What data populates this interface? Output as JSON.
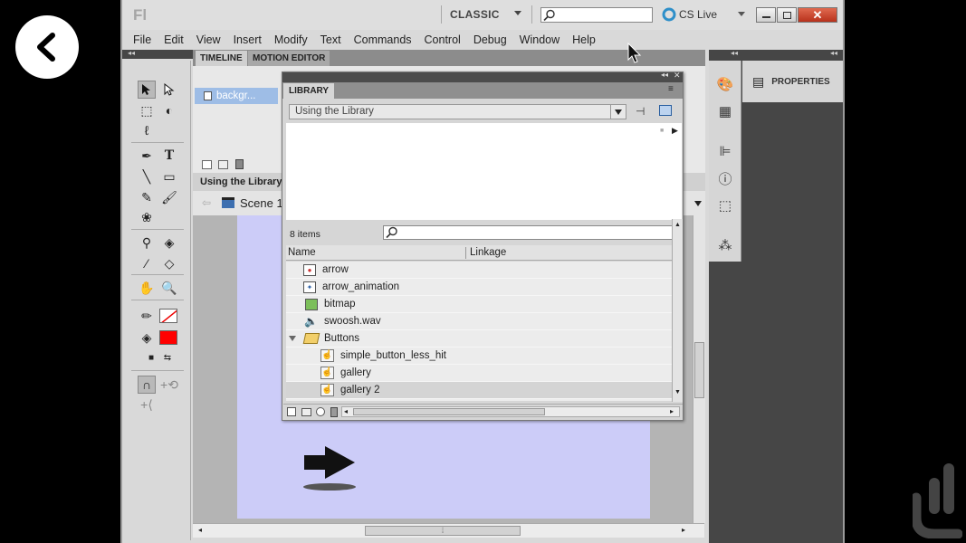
{
  "app": {
    "logo": "Fl",
    "workspace": "CLASSIC",
    "search_placeholder": "",
    "cslive": "CS Live"
  },
  "menu": [
    "File",
    "Edit",
    "View",
    "Insert",
    "Modify",
    "Text",
    "Commands",
    "Control",
    "Debug",
    "Window",
    "Help"
  ],
  "timeline": {
    "tabs": [
      "TIMELINE",
      "MOTION EDITOR"
    ],
    "layer_name": "backgr..."
  },
  "breadcrumb": "Using the Library",
  "scene_label": "Scene 1",
  "properties_tab": "PROPERTIES",
  "library": {
    "tab": "LIBRARY",
    "document": "Using the Library",
    "item_count": "8 items",
    "search_placeholder": "",
    "columns": {
      "name": "Name",
      "linkage": "Linkage"
    },
    "items": [
      {
        "name": "arrow",
        "icon": "movieclip-icon",
        "indent": 0,
        "selected": false
      },
      {
        "name": "arrow_animation",
        "icon": "movieclip-icon",
        "indent": 0,
        "selected": false
      },
      {
        "name": "bitmap",
        "icon": "bitmap-icon",
        "indent": 0,
        "selected": false
      },
      {
        "name": "swoosh.wav",
        "icon": "sound-icon",
        "indent": 0,
        "selected": false
      },
      {
        "name": "Buttons",
        "icon": "folder-open-icon",
        "indent": 0,
        "selected": false,
        "folder": true
      },
      {
        "name": "simple_button_less_hit",
        "icon": "button-symbol-icon",
        "indent": 1,
        "selected": false
      },
      {
        "name": "gallery",
        "icon": "button-symbol-icon",
        "indent": 1,
        "selected": false
      },
      {
        "name": "gallery 2",
        "icon": "button-symbol-icon",
        "indent": 1,
        "selected": true
      }
    ]
  },
  "colors": {
    "stage": "#ccccf8",
    "fill_color": "#ff0000",
    "selection": "#9ebde6",
    "dark_chrome": "#464646"
  }
}
